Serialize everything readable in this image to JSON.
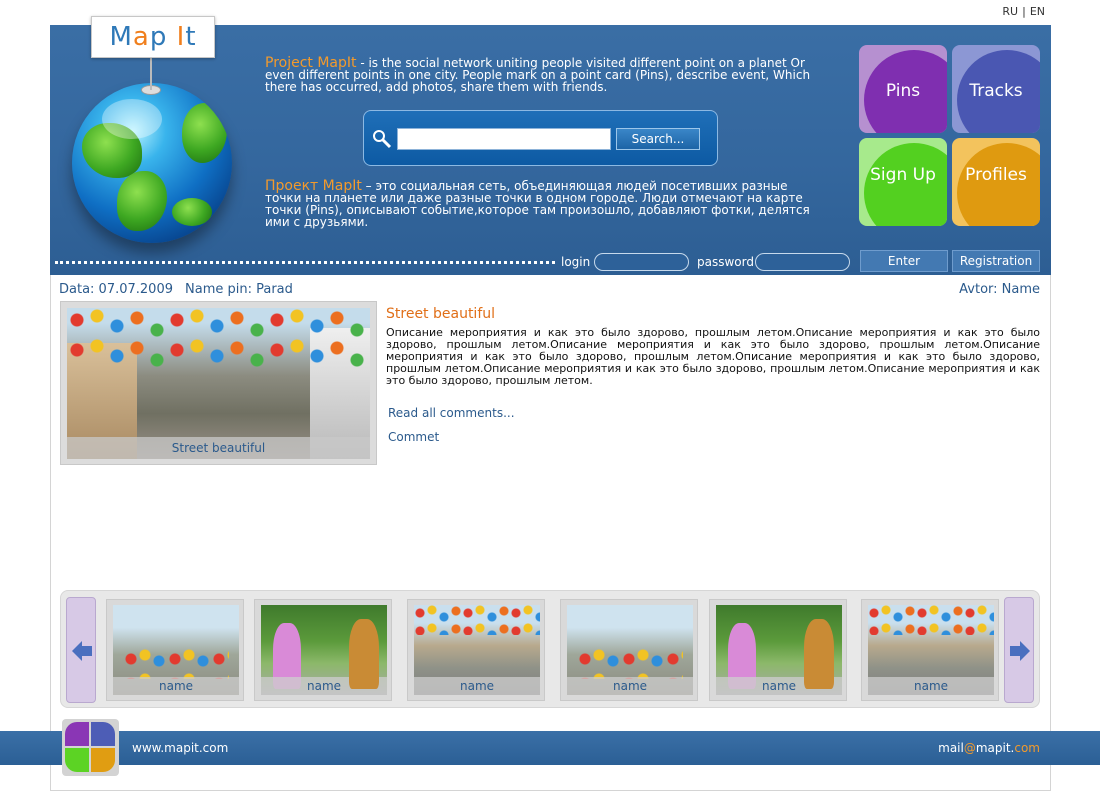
{
  "lang": {
    "ru": "RU",
    "sep": "|",
    "en": "EN"
  },
  "header": {
    "logo": {
      "m": "M",
      "a": "a",
      "p": "p",
      "space": " ",
      "i": "I",
      "t": "t"
    },
    "intro_en": {
      "highlight": "Project MapIt",
      "text": " - is the social network uniting people visited different point on a planet Or even different points in one city. People mark on a point card (Pins), describe event, Which there has occurred, add photos, share them with friends."
    },
    "intro_ru": {
      "highlight": "Проект MapIt",
      "text": " – это социальная сеть, объединяющая людей посетивших разные точки на планете или даже разные точки в одном городе. Люди отмечают на карте точки (Pins), описывают событие,которое там произошло, добавляют фотки, делятся ими с друзьями."
    },
    "search": {
      "value": "",
      "button": "Search..."
    },
    "nav": {
      "pins": "Pins",
      "tracks": "Tracks",
      "signup": "Sign Up",
      "profiles": "Profiles"
    },
    "login": {
      "login_label": "login",
      "password_label": "password",
      "enter": "Enter",
      "registration": "Registration"
    }
  },
  "meta": {
    "date": "Data: 07.07.2009",
    "pin": "Name pin: Parad",
    "author": "Avtor: Name"
  },
  "post": {
    "photo_caption": "Street beautiful",
    "title": "Street beautiful",
    "body": "Описание мероприятия и как это было здорово, прошлым летом.Описание мероприятия и как это было здорово, прошлым летом.Описание мероприятия и как это было здорово, прошлым летом.Описание мероприятия и как это было здорово, прошлым летом.Описание мероприятия и как это было здорово, прошлым летом.Описание мероприятия и как это было здорово, прошлым летом.Описание мероприятия и как это было здорово, прошлым летом.",
    "read_comments": "Read all comments...",
    "comment": "Commet"
  },
  "gallery": {
    "thumbs": [
      {
        "caption": "name",
        "kind": "parade"
      },
      {
        "caption": "name",
        "kind": "costume"
      },
      {
        "caption": "name",
        "kind": "street"
      },
      {
        "caption": "name",
        "kind": "parade"
      },
      {
        "caption": "name",
        "kind": "costume"
      },
      {
        "caption": "name",
        "kind": "street"
      }
    ]
  },
  "footer": {
    "site": "www.mapit.com",
    "mail_user": "mail",
    "mail_at": "@",
    "mail_domain": "mapit.",
    "mail_tld": "com"
  }
}
